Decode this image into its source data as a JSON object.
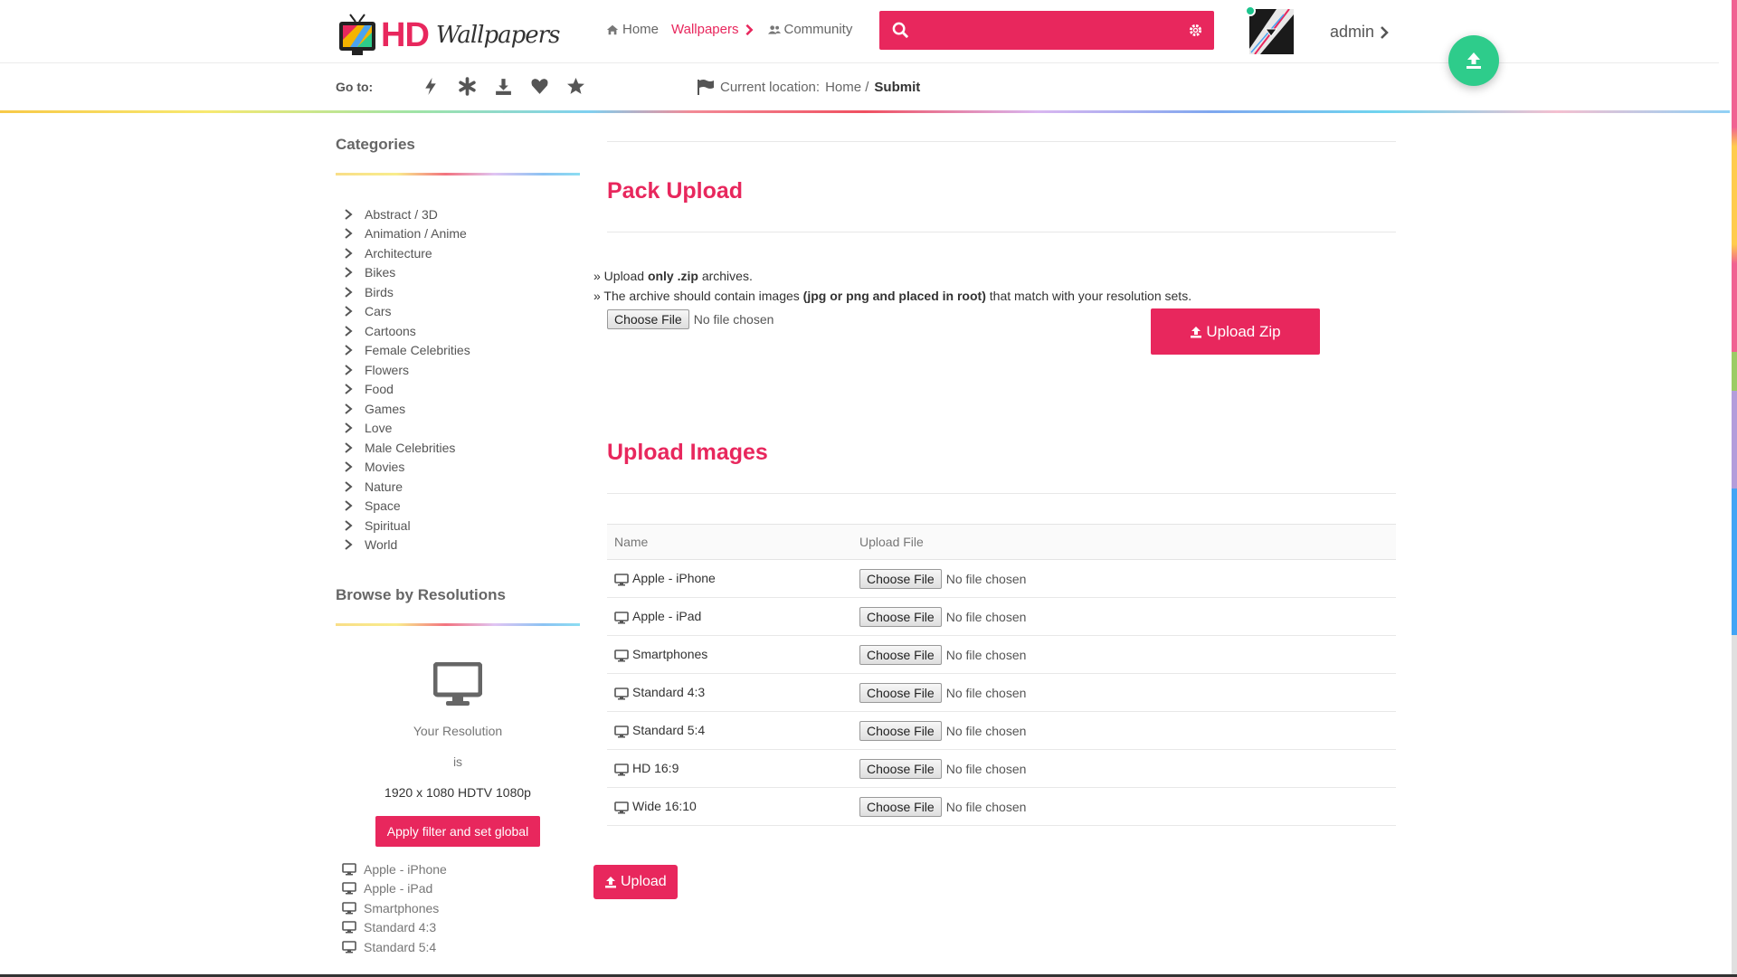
{
  "brand": {
    "logo_main": "HD",
    "logo_script": "Wallpapers",
    "accent": "#e8275d",
    "fab_color": "#2ecc8b"
  },
  "nav": {
    "items": [
      {
        "label": "Home",
        "icon": "home-icon"
      },
      {
        "label": "Wallpapers",
        "icon": "chevron-right-icon"
      },
      {
        "label": "Community",
        "icon": "users-icon"
      }
    ]
  },
  "search": {
    "value": "",
    "placeholder": ""
  },
  "user": {
    "name": "admin"
  },
  "subbar": {
    "goto_label": "Go to:",
    "goto_icons": [
      "bolt-icon",
      "asterisk-icon",
      "download-icon",
      "heart-icon",
      "star-icon"
    ],
    "location_label": "Current location:",
    "location_home": "Home /",
    "location_current": "Submit"
  },
  "sidebar": {
    "categories_title": "Categories",
    "categories": [
      "Abstract / 3D",
      "Animation / Anime",
      "Architecture",
      "Bikes",
      "Birds",
      "Cars",
      "Cartoons",
      "Female Celebrities",
      "Flowers",
      "Food",
      "Games",
      "Love",
      "Male Celebrities",
      "Movies",
      "Nature",
      "Space",
      "Spiritual",
      "World"
    ],
    "resolutions_title": "Browse by Resolutions",
    "your_resolution": "Your Resolution",
    "is_label": "is",
    "resolution_value": "1920 x 1080 HDTV 1080p",
    "apply_button": "Apply filter and set global",
    "devices": [
      "Apple - iPhone",
      "Apple - iPad",
      "Smartphones",
      "Standard 4:3",
      "Standard 5:4"
    ]
  },
  "pack": {
    "title": "Pack Upload",
    "note1_pre": "» Upload ",
    "note1_bold": "only .zip",
    "note1_post": " archives.",
    "note2_pre": "» The archive should contain images ",
    "note2_bold": "(jpg or png and placed in root)",
    "note2_post": " that match with your resolution sets.",
    "choose_label": "Choose File",
    "no_file": "No file chosen",
    "upload_zip": "Upload Zip"
  },
  "images": {
    "title": "Upload Images",
    "col_name": "Name",
    "col_file": "Upload File",
    "choose_label": "Choose File",
    "no_file": "No file chosen",
    "rows": [
      "Apple - iPhone",
      "Apple - iPad",
      "Smartphones",
      "Standard 4:3",
      "Standard 5:4",
      "HD 16:9",
      "Wide 16:10"
    ],
    "upload_button": "Upload"
  }
}
